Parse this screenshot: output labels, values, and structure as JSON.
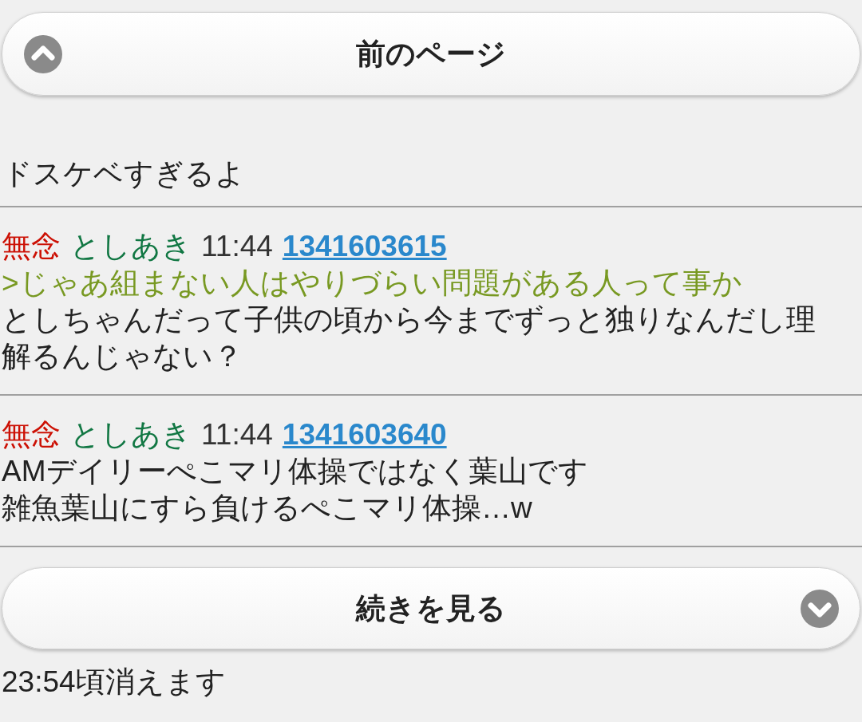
{
  "prev_button": {
    "label": "前のページ"
  },
  "previous_post_tail": {
    "text": "ドスケベすぎるよ"
  },
  "posts": [
    {
      "name_label": "無念",
      "name": "としあき",
      "time": "11:44",
      "number": "1341603615",
      "lines": [
        {
          "kind": "quote",
          "text": ">じゃあ組まない人はやりづらい問題がある人って事か"
        },
        {
          "kind": "text",
          "text": "としちゃんだって子供の頃から今までずっと独りなんだし理解るんじゃない？"
        }
      ]
    },
    {
      "name_label": "無念",
      "name": "としあき",
      "time": "11:44",
      "number": "1341603640",
      "lines": [
        {
          "kind": "text",
          "text": "AMデイリーぺこマリ体操ではなく葉山です"
        },
        {
          "kind": "text",
          "text": "雑魚葉山にすら負けるぺこマリ体操…w"
        }
      ]
    }
  ],
  "next_button": {
    "label": "続きを見る"
  },
  "footer": {
    "text": "23:54頃消えます"
  }
}
